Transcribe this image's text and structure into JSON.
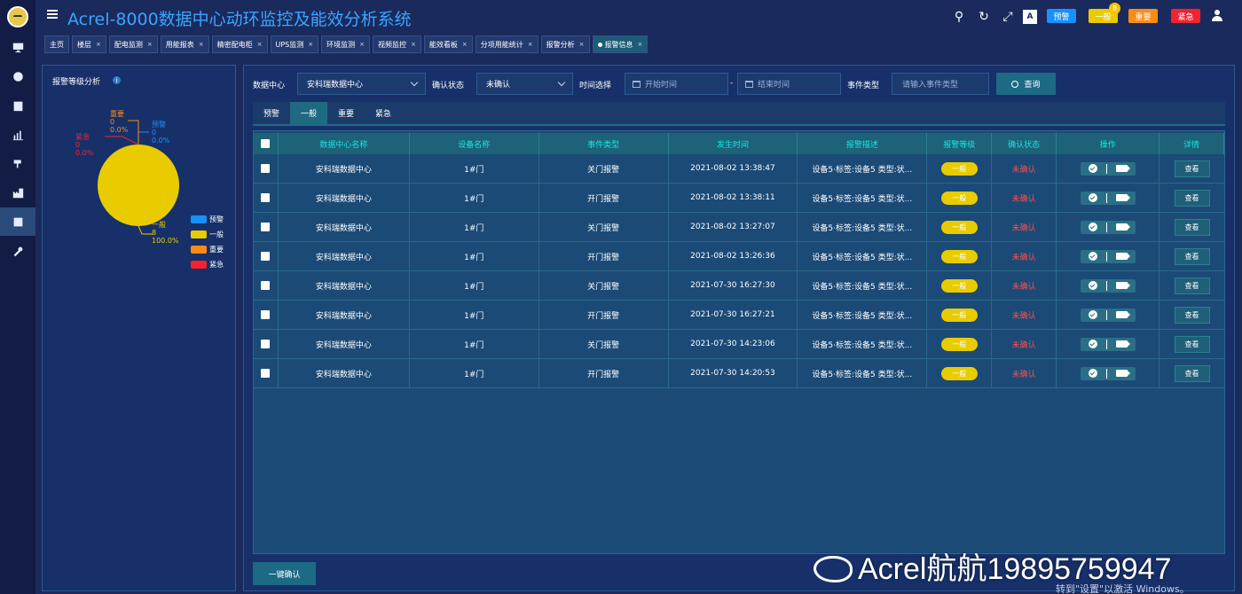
{
  "app": {
    "title": "Acrel-8000数据中心动环监控及能效分析系统"
  },
  "toolbar": {
    "levels": [
      {
        "label": "预警",
        "color": "#1890ff"
      },
      {
        "label": "一般",
        "color": "#e8cc00",
        "badge": "8"
      },
      {
        "label": "重要",
        "color": "#fa8c16"
      },
      {
        "label": "紧急",
        "color": "#f5222d"
      }
    ]
  },
  "sidebar": {
    "items": [
      "monitor-icon",
      "globe-icon",
      "building-icon",
      "bar-chart-icon",
      "camera-icon",
      "factory-icon",
      "report-icon",
      "tools-icon"
    ]
  },
  "tabs": [
    {
      "label": "主页",
      "closable": false
    },
    {
      "label": "楼层",
      "closable": true
    },
    {
      "label": "配电监测",
      "closable": true
    },
    {
      "label": "用能报表",
      "closable": true
    },
    {
      "label": "精密配电柜",
      "closable": true
    },
    {
      "label": "UPS监测",
      "closable": true
    },
    {
      "label": "环境监测",
      "closable": true
    },
    {
      "label": "视频监控",
      "closable": true
    },
    {
      "label": "能效看板",
      "closable": true
    },
    {
      "label": "分项用能统计",
      "closable": true
    },
    {
      "label": "报警分析",
      "closable": true
    },
    {
      "label": "报警信息",
      "closable": true,
      "active": true
    }
  ],
  "left_panel": {
    "title": "报警等级分析",
    "info_icon": "i"
  },
  "chart_data": {
    "type": "pie",
    "categories": [
      "预警",
      "一般",
      "重要",
      "紧急"
    ],
    "values": [
      0,
      8,
      0,
      0
    ],
    "percents": [
      "0.0%",
      "100.0%",
      "0.0%",
      "0.0%"
    ],
    "colors": [
      "#1890ff",
      "#e8cc00",
      "#fa8c16",
      "#f5222d"
    ],
    "labels": [
      {
        "name": "预警",
        "value": "0",
        "percent": "0.0%",
        "color": "#1890ff"
      },
      {
        "name": "一般",
        "value": "8",
        "percent": "100.0%",
        "color": "#e8cc00"
      },
      {
        "name": "重要",
        "value": "0",
        "percent": "0.0%",
        "color": "#fa8c16"
      },
      {
        "name": "紧急",
        "value": "0",
        "percent": "0.0%",
        "color": "#f5222d"
      }
    ],
    "legend": [
      "预警",
      "一般",
      "重要",
      "紧急"
    ],
    "legend_placement": "bottom-right"
  },
  "filters": {
    "datacenter_label": "数据中心",
    "datacenter_value": "安科瑞数据中心",
    "confirm_label": "确认状态",
    "confirm_value": "未确认",
    "time_label": "时间选择",
    "start_placeholder": "开始时间",
    "dash": "-",
    "end_placeholder": "结束时间",
    "event_label": "事件类型",
    "event_placeholder": "请输入事件类型",
    "search_label": "查询"
  },
  "sub_tabs": [
    {
      "label": "预警"
    },
    {
      "label": "一般",
      "active": true
    },
    {
      "label": "重要"
    },
    {
      "label": "紧急"
    }
  ],
  "table": {
    "headers": [
      "数据中心名称",
      "设备名称",
      "事件类型",
      "发生时间",
      "报警描述",
      "报警等级",
      "确认状态",
      "操作",
      "详情"
    ],
    "rows": [
      {
        "dc": "安科瑞数据中心",
        "device": "1#门",
        "event": "关门报警",
        "time": "2021-08-02 13:38:47",
        "desc": "设备5·标签:设备5 类型:状...",
        "level": "一般",
        "status": "未确认",
        "detail": "查看"
      },
      {
        "dc": "安科瑞数据中心",
        "device": "1#门",
        "event": "开门报警",
        "time": "2021-08-02 13:38:11",
        "desc": "设备5·标签:设备5 类型:状...",
        "level": "一般",
        "status": "未确认",
        "detail": "查看"
      },
      {
        "dc": "安科瑞数据中心",
        "device": "1#门",
        "event": "关门报警",
        "time": "2021-08-02 13:27:07",
        "desc": "设备5·标签:设备5 类型:状...",
        "level": "一般",
        "status": "未确认",
        "detail": "查看"
      },
      {
        "dc": "安科瑞数据中心",
        "device": "1#门",
        "event": "开门报警",
        "time": "2021-08-02 13:26:36",
        "desc": "设备5·标签:设备5 类型:状...",
        "level": "一般",
        "status": "未确认",
        "detail": "查看"
      },
      {
        "dc": "安科瑞数据中心",
        "device": "1#门",
        "event": "关门报警",
        "time": "2021-07-30 16:27:30",
        "desc": "设备5·标签:设备5 类型:状...",
        "level": "一般",
        "status": "未确认",
        "detail": "查看"
      },
      {
        "dc": "安科瑞数据中心",
        "device": "1#门",
        "event": "开门报警",
        "time": "2021-07-30 16:27:21",
        "desc": "设备5·标签:设备5 类型:状...",
        "level": "一般",
        "status": "未确认",
        "detail": "查看"
      },
      {
        "dc": "安科瑞数据中心",
        "device": "1#门",
        "event": "关门报警",
        "time": "2021-07-30 14:23:06",
        "desc": "设备5·标签:设备5 类型:状...",
        "level": "一般",
        "status": "未确认",
        "detail": "查看"
      },
      {
        "dc": "安科瑞数据中心",
        "device": "1#门",
        "event": "开门报警",
        "time": "2021-07-30 14:20:53",
        "desc": "设备5·标签:设备5 类型:状...",
        "level": "一般",
        "status": "未确认",
        "detail": "查看"
      }
    ]
  },
  "footer": {
    "confirm_all": "一键确认",
    "watermark": "Acrel航航19895759947",
    "windows_note": "转到\"设置\"以激活 Windows。"
  }
}
